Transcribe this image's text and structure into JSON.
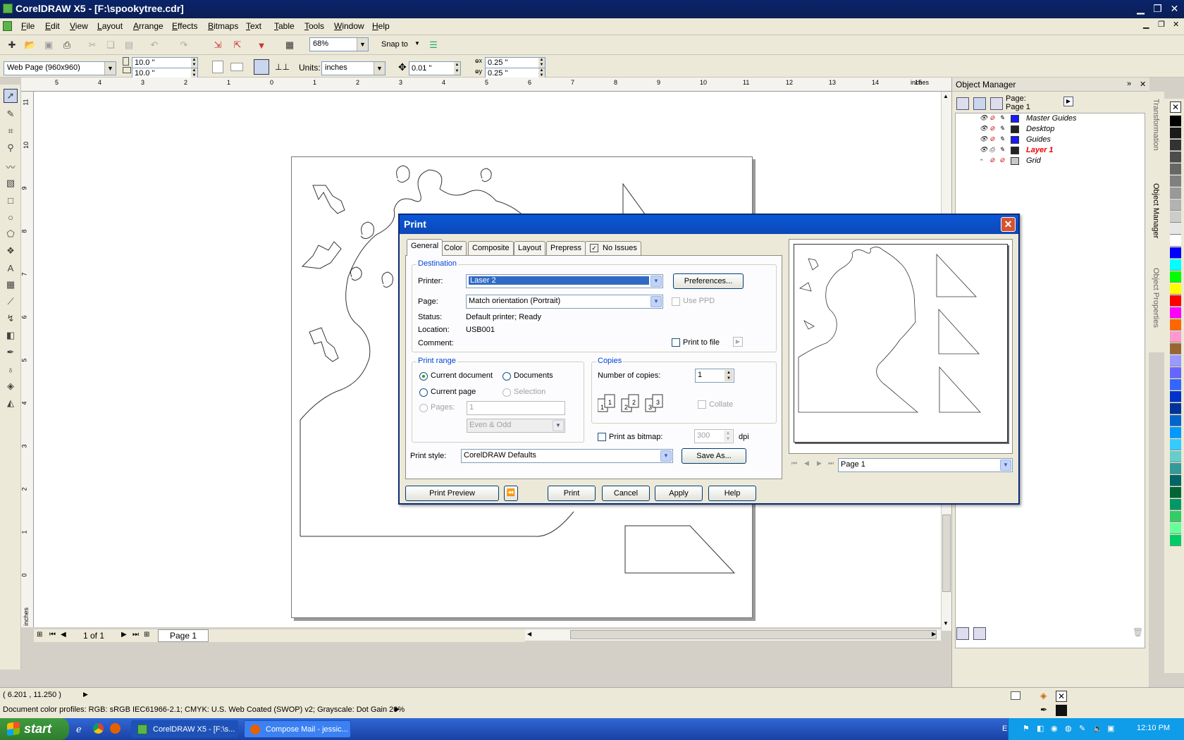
{
  "window": {
    "title": "CorelDRAW X5 - [F:\\spookytree.cdr]"
  },
  "menu": [
    "File",
    "Edit",
    "View",
    "Layout",
    "Arrange",
    "Effects",
    "Bitmaps",
    "Text",
    "Table",
    "Tools",
    "Window",
    "Help"
  ],
  "toolbar1": {
    "zoom": "68%",
    "snap_to": "Snap to"
  },
  "toolbar2": {
    "page_preset": "Web Page (960x960)",
    "width": "10.0 \"",
    "height": "10.0 \"",
    "units_label": "Units:",
    "units": "inches",
    "nudge": "0.01 \"",
    "dup_x": "0.25 \"",
    "dup_y": "0.25 \""
  },
  "ruler": {
    "h_ticks": [
      "5",
      "4",
      "3",
      "2",
      "1",
      "0",
      "1",
      "2",
      "3",
      "4",
      "5",
      "6",
      "7",
      "8",
      "9",
      "10",
      "11",
      "12",
      "13",
      "14",
      "15"
    ],
    "h_unit": "inches",
    "v_ticks": [
      "11",
      "10",
      "9",
      "8",
      "7",
      "6",
      "5",
      "4",
      "3",
      "2",
      "1",
      "0"
    ],
    "v_unit": "inches"
  },
  "page_nav": {
    "counter": "1 of 1",
    "tab": "Page 1"
  },
  "object_manager": {
    "title": "Object Manager",
    "page_label": "Page:",
    "page_name": "Page 1",
    "layers": [
      {
        "name": "Master Guides",
        "color": "#1a1aff"
      },
      {
        "name": "Desktop",
        "color": "#222222"
      },
      {
        "name": "Guides",
        "color": "#1a1aff"
      },
      {
        "name": "Layer 1",
        "color": "#222222"
      },
      {
        "name": "Grid",
        "color": "#c8c8c8"
      }
    ]
  },
  "side_tabs": [
    "Transformation",
    "Object Manager",
    "Object Properties"
  ],
  "palette": [
    "#000000",
    "#1a1a1a",
    "#333333",
    "#4d4d4d",
    "#666666",
    "#808080",
    "#999999",
    "#b3b3b3",
    "#cccccc",
    "#e6e6e6",
    "#ffffff",
    "#0000ff",
    "#00ffff",
    "#00ff00",
    "#ffff00",
    "#ff0000",
    "#ff00ff",
    "#ff6600",
    "#ff99cc",
    "#996633",
    "#9999ff",
    "#6666ff",
    "#3366ff",
    "#0033cc",
    "#003399",
    "#0066cc",
    "#0099ff",
    "#33ccff",
    "#66cccc",
    "#339999",
    "#006666",
    "#006633",
    "#009966",
    "#33cc66",
    "#66ff99",
    "#00cc66"
  ],
  "status": {
    "coords": "( 6.201 , 11.250 )",
    "profile": "Document color profiles: RGB: sRGB IEC61966-2.1; CMYK: U.S. Web Coated (SWOP) v2; Grayscale: Dot Gain 20%"
  },
  "taskbar": {
    "start": "start",
    "tasks": [
      "CorelDRAW X5 - [F:\\s...",
      "Compose Mail - jessic..."
    ],
    "lang": "EN",
    "clock": "12:10 PM"
  },
  "print_dialog": {
    "title": "Print",
    "tabs": [
      "General",
      "Color",
      "Composite",
      "Layout",
      "Prepress",
      "No Issues"
    ],
    "destination_label": "Destination",
    "printer_label": "Printer:",
    "printer_value": "Laser 2",
    "preferences_button": "Preferences...",
    "page_label": "Page:",
    "page_value": "Match orientation (Portrait)",
    "use_ppd": "Use PPD",
    "status_label": "Status:",
    "status_value": "Default printer; Ready",
    "location_label": "Location:",
    "location_value": "USB001",
    "comment_label": "Comment:",
    "print_to_file": "Print to file",
    "print_range_label": "Print range",
    "current_document": "Current document",
    "documents": "Documents",
    "current_page": "Current page",
    "selection": "Selection",
    "pages_label": "Pages:",
    "pages_value": "1",
    "even_odd": "Even & Odd",
    "copies_label": "Copies",
    "num_copies_label": "Number of copies:",
    "num_copies_value": "1",
    "collate": "Collate",
    "print_as_bitmap": "Print as bitmap:",
    "dpi_value": "300",
    "dpi_unit": "dpi",
    "print_style_label": "Print style:",
    "print_style_value": "CorelDRAW Defaults",
    "save_as_button": "Save As...",
    "preview_page": "Page 1",
    "buttons": {
      "print_preview": "Print Preview",
      "print": "Print",
      "cancel": "Cancel",
      "apply": "Apply",
      "help": "Help"
    }
  }
}
